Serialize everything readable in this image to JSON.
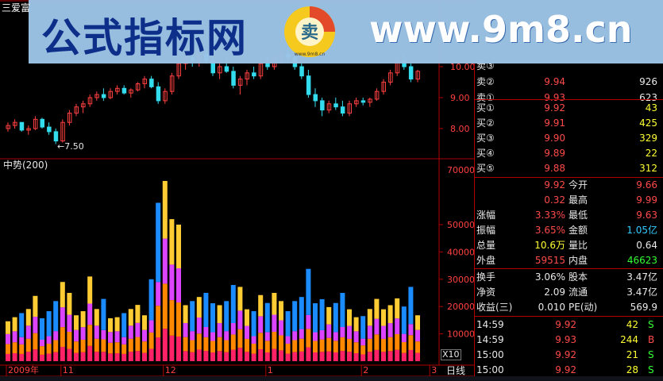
{
  "app": {
    "title": "三爱富"
  },
  "watermark": {
    "left_text": "公式指标网",
    "right_text": "www.9m8.cn",
    "logo_glyph": "卖",
    "logo_url": "www.9m8.cn"
  },
  "price_chart": {
    "low_marker": "←7.50",
    "y_ticks": [
      "10.00",
      "9.00",
      "8.00",
      "70000"
    ],
    "y_values": [
      10.0,
      9.0,
      8.0
    ],
    "candles": [
      [
        8.0,
        8.2,
        7.9,
        8.1
      ],
      [
        8.1,
        8.3,
        8.0,
        8.2
      ],
      [
        8.2,
        8.2,
        7.9,
        7.95
      ],
      [
        7.95,
        8.1,
        7.8,
        8.0
      ],
      [
        8.0,
        8.4,
        7.95,
        8.3
      ],
      [
        8.3,
        8.35,
        8.0,
        8.05
      ],
      [
        8.05,
        8.2,
        7.8,
        7.9
      ],
      [
        7.9,
        8.0,
        7.5,
        7.6
      ],
      [
        7.6,
        8.3,
        7.55,
        8.2
      ],
      [
        8.2,
        8.6,
        8.1,
        8.5
      ],
      [
        8.5,
        8.8,
        8.4,
        8.7
      ],
      [
        8.7,
        8.9,
        8.5,
        8.8
      ],
      [
        8.8,
        9.1,
        8.7,
        9.0
      ],
      [
        9.0,
        9.2,
        8.9,
        9.1
      ],
      [
        9.1,
        9.3,
        8.9,
        9.0
      ],
      [
        9.0,
        9.3,
        8.95,
        9.2
      ],
      [
        9.2,
        9.4,
        9.1,
        9.3
      ],
      [
        9.3,
        9.4,
        9.1,
        9.15
      ],
      [
        9.15,
        9.3,
        9.0,
        9.25
      ],
      [
        9.25,
        9.5,
        9.2,
        9.45
      ],
      [
        9.45,
        9.7,
        9.3,
        9.6
      ],
      [
        9.6,
        9.7,
        9.3,
        9.35
      ],
      [
        9.35,
        9.5,
        8.8,
        8.9
      ],
      [
        8.9,
        9.3,
        8.8,
        9.2
      ],
      [
        9.2,
        9.8,
        9.1,
        9.7
      ],
      [
        9.7,
        10.2,
        9.6,
        10.1
      ],
      [
        10.1,
        10.4,
        9.9,
        10.3
      ],
      [
        10.3,
        10.5,
        10.0,
        10.2
      ],
      [
        10.2,
        10.5,
        10.0,
        10.4
      ],
      [
        10.4,
        10.6,
        10.1,
        10.2
      ],
      [
        10.2,
        10.3,
        9.7,
        9.8
      ],
      [
        9.8,
        10.1,
        9.6,
        10.0
      ],
      [
        10.0,
        10.3,
        9.8,
        9.85
      ],
      [
        9.85,
        10.0,
        9.3,
        9.4
      ],
      [
        9.4,
        9.7,
        9.1,
        9.6
      ],
      [
        9.6,
        9.9,
        9.4,
        9.8
      ],
      [
        9.8,
        10.0,
        9.6,
        9.7
      ],
      [
        9.7,
        10.2,
        9.6,
        10.1
      ],
      [
        10.1,
        10.3,
        9.9,
        10.0
      ],
      [
        10.0,
        10.4,
        9.9,
        10.3
      ],
      [
        10.3,
        10.5,
        10.1,
        10.4
      ],
      [
        10.4,
        10.6,
        10.2,
        10.3
      ],
      [
        10.3,
        10.4,
        9.9,
        10.0
      ],
      [
        10.0,
        10.1,
        9.6,
        9.7
      ],
      [
        9.7,
        9.9,
        9.0,
        9.1
      ],
      [
        9.1,
        9.3,
        8.7,
        8.9
      ],
      [
        8.9,
        9.0,
        8.4,
        8.6
      ],
      [
        8.6,
        8.9,
        8.5,
        8.8
      ],
      [
        8.8,
        9.0,
        8.6,
        8.7
      ],
      [
        8.7,
        8.9,
        8.4,
        8.5
      ],
      [
        8.5,
        8.9,
        8.4,
        8.8
      ],
      [
        8.8,
        9.0,
        8.7,
        8.9
      ],
      [
        8.9,
        9.0,
        8.75,
        8.85
      ],
      [
        8.85,
        9.0,
        8.7,
        8.95
      ],
      [
        8.95,
        9.3,
        8.9,
        9.2
      ],
      [
        9.2,
        9.6,
        9.1,
        9.5
      ],
      [
        9.5,
        9.9,
        9.4,
        9.8
      ],
      [
        9.8,
        10.3,
        9.7,
        10.2
      ],
      [
        10.2,
        10.4,
        9.9,
        10.0
      ],
      [
        10.0,
        10.1,
        9.5,
        9.6
      ],
      [
        9.6,
        9.9,
        9.5,
        9.85
      ]
    ]
  },
  "volume_chart": {
    "label": "中势(200)",
    "y_ticks": [
      "50000",
      "40000",
      "30000",
      "20000",
      "10000"
    ],
    "y_values": [
      50000,
      40000,
      30000,
      20000,
      10000
    ],
    "multiplier": "X10",
    "period": "日线",
    "x_labels": [
      {
        "text": "2009年",
        "index": 0
      },
      {
        "text": "11",
        "index": 8
      },
      {
        "text": "12",
        "index": 23
      },
      {
        "text": "1",
        "index": 38
      },
      {
        "text": "2",
        "index": 52
      },
      {
        "text": "3",
        "index": 62
      }
    ]
  },
  "quote_panel": {
    "asks": [
      {
        "label": "卖③",
        "price": "",
        "vol": ""
      },
      {
        "label": "卖②",
        "price": "9.94",
        "vol": "926"
      },
      {
        "label": "卖①",
        "price": "9.93",
        "vol": "623"
      }
    ],
    "bids": [
      {
        "label": "买①",
        "price": "9.92",
        "vol": "43"
      },
      {
        "label": "买②",
        "price": "9.91",
        "vol": "425"
      },
      {
        "label": "买③",
        "price": "9.90",
        "vol": "329"
      },
      {
        "label": "买④",
        "price": "9.89",
        "vol": "22"
      },
      {
        "label": "买⑤",
        "price": "9.88",
        "vol": "312"
      }
    ],
    "stats": [
      {
        "l1": "",
        "v1": "9.92",
        "l2": "今开",
        "v2": "9.66"
      },
      {
        "l1": "",
        "v1": "0.32",
        "l2": "最高",
        "v2": "9.99"
      },
      {
        "l1": "涨幅",
        "v1": "3.33%",
        "l2": "最低",
        "v2": "9.63"
      },
      {
        "l1": "振幅",
        "v1": "3.65%",
        "l2": "金额",
        "v2": "1.05亿"
      },
      {
        "l1": "总量",
        "v1": "10.6万",
        "l2": "量比",
        "v2": "0.64"
      },
      {
        "l1": "外盘",
        "v1": "59515",
        "l2": "内盘",
        "v2": "46623"
      }
    ],
    "finance": [
      {
        "l1": "换手",
        "v1": "3.06%",
        "l2": "股本",
        "v2": "3.47亿"
      },
      {
        "l1": "净资",
        "v1": "2.09",
        "l2": "流通",
        "v2": "3.47亿"
      },
      {
        "l1": "收益(三)",
        "v1": "0.010",
        "l2": "PE(动)",
        "v2": "569.9"
      }
    ],
    "ticks": [
      {
        "time": "14:59",
        "price": "9.92",
        "vol": "42",
        "side": "S"
      },
      {
        "time": "14:59",
        "price": "9.93",
        "vol": "244",
        "side": "B"
      },
      {
        "time": "15:00",
        "price": "9.92",
        "vol": "21",
        "side": "S"
      },
      {
        "time": "15:00",
        "price": "9.92",
        "vol": "28",
        "side": "S"
      }
    ]
  },
  "colors": {
    "up": "#ff4040",
    "down": "#33ddee",
    "grid": "#b00000",
    "vol_red": "#ff2266",
    "vol_orange": "#ff8800",
    "vol_magenta": "#dd44ff",
    "vol_yellow": "#ffcc33",
    "vol_blue": "#1a8cff"
  }
}
